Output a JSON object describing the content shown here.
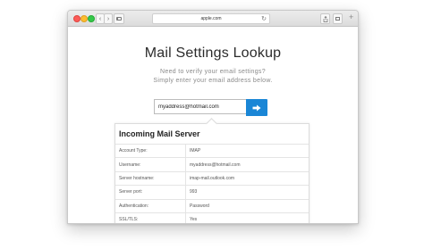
{
  "browser": {
    "address": "apple.com",
    "icons": {
      "back": "chevron-left-icon",
      "forward": "chevron-right-icon",
      "sidebar": "sidebar-icon",
      "reload": "reload-icon",
      "share": "share-icon",
      "tabs": "tabs-icon",
      "new_tab": "plus-icon"
    }
  },
  "page": {
    "title": "Mail Settings Lookup",
    "subtitle_line1": "Need to verify your email settings?",
    "subtitle_line2": "Simply enter your email address below."
  },
  "form": {
    "email_value": "myaddress@hotmail.com",
    "submit_icon": "arrow-right-icon",
    "submit_color": "#1a86d6"
  },
  "result": {
    "title": "Incoming Mail Server",
    "rows": [
      {
        "label": "Account Type:",
        "value": "IMAP"
      },
      {
        "label": "Username:",
        "value": "myaddress@hotmail.com"
      },
      {
        "label": "Server hostname:",
        "value": "imap-mail.outlook.com"
      },
      {
        "label": "Server port:",
        "value": "993"
      },
      {
        "label": "Authentication:",
        "value": "Password"
      },
      {
        "label": "SSL/TLS:",
        "value": "Yes"
      }
    ]
  }
}
